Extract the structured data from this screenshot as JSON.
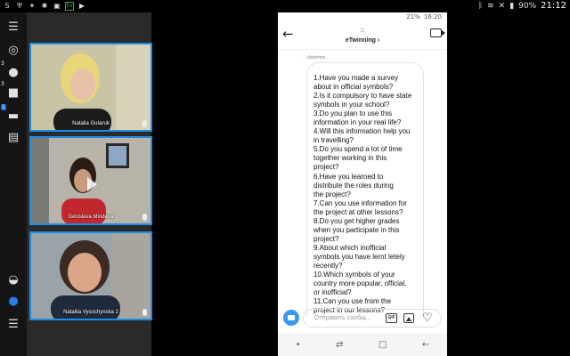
{
  "system_status": {
    "left_icons": [
      "S",
      "shield",
      "wrench",
      "bug",
      "image",
      "Ex",
      "play"
    ],
    "right_icons": [
      "bluetooth",
      "wifi",
      "mute",
      "signal"
    ],
    "battery": "90%",
    "time": "21:12"
  },
  "toolbar": {
    "items": [
      {
        "icon": "layout-icon",
        "glyph": "☰"
      },
      {
        "icon": "broadcast-icon",
        "glyph": "◎"
      },
      {
        "icon": "participants-icon",
        "glyph": "●",
        "badge": "3"
      },
      {
        "icon": "camera-icon",
        "glyph": "■",
        "badge": "3"
      },
      {
        "icon": "chat-icon",
        "glyph": "▬",
        "badge": "1"
      },
      {
        "icon": "notes-icon",
        "glyph": "▤"
      },
      {
        "icon": "share-icon",
        "glyph": "◒"
      },
      {
        "icon": "microphone-icon",
        "glyph": "●"
      },
      {
        "icon": "menu-icon",
        "glyph": "☰"
      }
    ]
  },
  "video_tiles": [
    {
      "name": "Natalia Gutaruk"
    },
    {
      "name": "Desislava Mindeva"
    },
    {
      "name": "Nataliia Vysochynska 2"
    }
  ],
  "phone": {
    "status": {
      "battery": "21%",
      "time": "16:20"
    },
    "header": {
      "title": "eTwinning ›"
    },
    "chat": {
      "clipped_line": "…distortion…",
      "message": "1.Have you made a survey\nabout in official symbols?\n2.Is it compulsory to have state\nsymbols in your school?\n3.Do you plan to use this\ninformation in your real life?\n4.Will this information help you\nin travelling?\n5.Do you spend a lot of time\ntogether working in this\nproject?\n6.Have you learned to\ndistribute the roles during\nthe project?\n7.Can you use information for\nthe project at other lessons?\n8.Do you get higher grades\nwhen you participate in this\nproject?\n9.About which inofficial\nsymbols you have lernt letely\nrecently?\n10.Which symbols of your\ncountry more popular, official,\nor inofficial?\n11.Can you use from the\nproject in our lessons?"
    },
    "composer": {
      "placeholder": "Отправить сообщ...",
      "gif_label": "GIF"
    },
    "nav": [
      "•",
      "⇄",
      "□",
      "←"
    ]
  }
}
